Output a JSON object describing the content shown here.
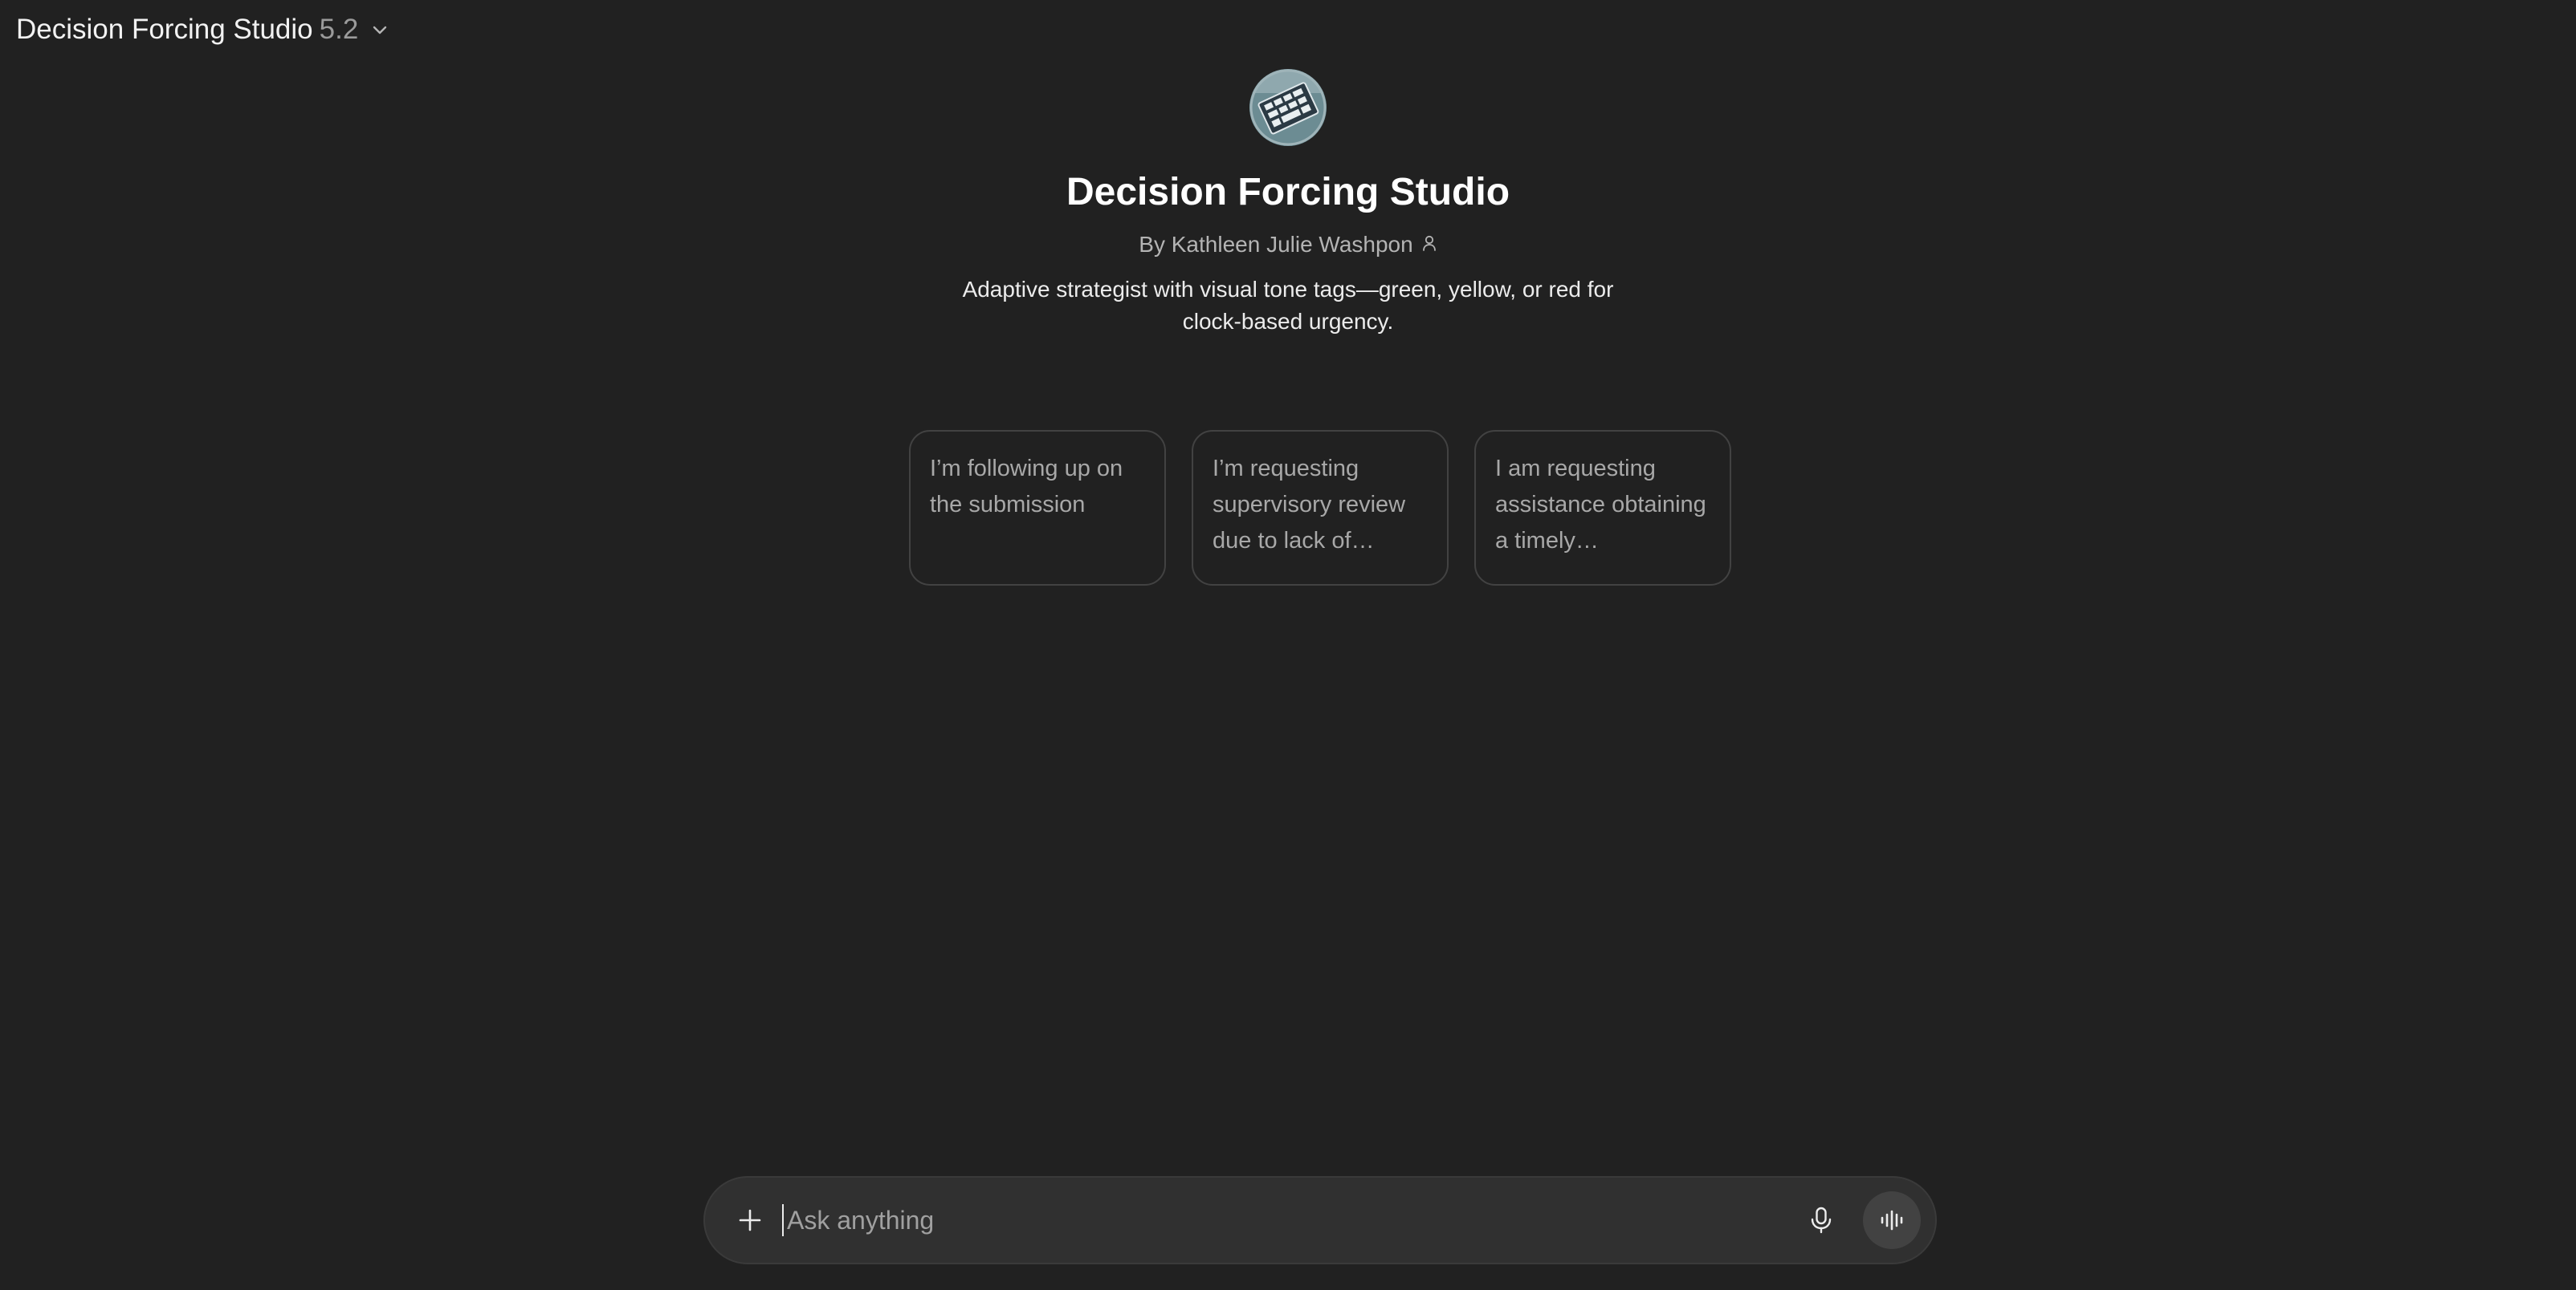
{
  "header": {
    "model_name": "Decision Forcing Studio",
    "model_version": "5.2",
    "chevron_icon": "chevron-down-icon"
  },
  "gpt": {
    "title": "Decision Forcing Studio",
    "byline": "By Kathleen Julie Washpon",
    "byline_icon": "person-icon",
    "description": "Adaptive strategist with visual tone tags—green, yellow, or red for clock-based urgency."
  },
  "starters": [
    {
      "text": "I’m following up on the submission"
    },
    {
      "text": "I’m requesting supervisory review due to lack of…"
    },
    {
      "text": "I am requesting assistance obtaining a timely…"
    }
  ],
  "composer": {
    "placeholder": "Ask anything",
    "value": "",
    "icons": [
      "plus-icon",
      "microphone-icon",
      "voice-waveform-icon"
    ]
  },
  "colors": {
    "background": "#212121",
    "composer": "#303030",
    "card_border": "#424242",
    "muted_text": "#a8a8a8"
  }
}
